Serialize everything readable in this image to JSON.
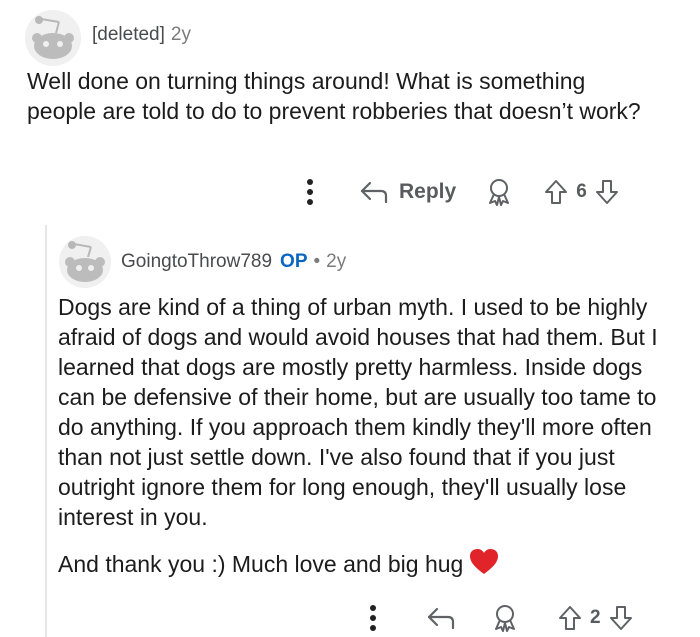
{
  "comment": {
    "author": "[deleted]",
    "age": "2y",
    "text": "Well done on turning things around! What is something people are told to do to prevent robberies that doesn’t work?",
    "actions": {
      "reply_label": "Reply",
      "vote_count": "6"
    }
  },
  "reply": {
    "author": "GoingtoThrow789",
    "badge": "OP",
    "separator": "•",
    "age": "2y",
    "paragraph1": "Dogs are kind of a thing of urban myth. I used to be highly afraid of dogs and would avoid houses that had them. But I learned that dogs are mostly pretty harmless. Inside dogs can be defensive of their home, but are usually too tame to do anything. If you approach them kindly they'll more often than not just settle down. I've also found that if you just outright ignore them for long enough, they'll usually lose interest in you.",
    "paragraph2": "And thank you :) Much love and big hug",
    "actions": {
      "vote_count": "2"
    }
  },
  "icons": {
    "more": "more-vertical-icon",
    "reply": "reply-arrow-icon",
    "award": "award-icon",
    "upvote": "upvote-arrow-icon",
    "downvote": "downvote-arrow-icon",
    "heart": "red-heart-emoji"
  },
  "colors": {
    "text": "#1c1c1c",
    "muted": "#7c7c7c",
    "op_badge": "#0a66c2",
    "heart": "#e0242a"
  }
}
